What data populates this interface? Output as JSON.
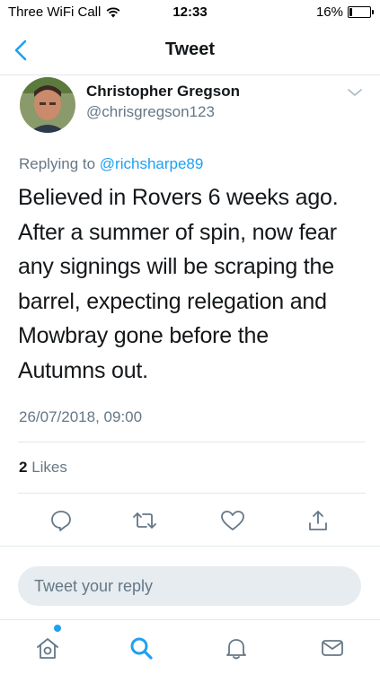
{
  "status_bar": {
    "carrier": "Three WiFi Call",
    "time": "12:33",
    "battery_percent": "16%",
    "battery_level": 0.16
  },
  "nav": {
    "title": "Tweet",
    "back_icon": "chevron-left-icon"
  },
  "tweet": {
    "author_name": "Christopher Gregson",
    "author_handle": "@chrisgregson123",
    "replying_prefix": "Replying to",
    "replying_to": "@richsharpe89",
    "text_lines": [
      "Believed in Rovers 6 weeks ago.",
      "After a summer of spin, now fear",
      "any signings will be scraping the",
      "barrel, expecting relegation and",
      "Mowbray gone before the",
      "Autumns out."
    ],
    "timestamp": "26/07/2018, 09:00",
    "likes_count": "2",
    "likes_label": "Likes"
  },
  "actions": [
    "reply-icon",
    "retweet-icon",
    "like-icon",
    "share-icon"
  ],
  "reply_box": {
    "placeholder": "Tweet your reply"
  },
  "tab_bar": {
    "items": [
      "home-icon",
      "search-icon",
      "notifications-icon",
      "messages-icon"
    ],
    "home_has_new": true
  },
  "colors": {
    "accent": "#1da1f2",
    "secondary_text": "#657786",
    "divider": "#e1e8ed",
    "reply_box_bg": "#e6ecf0"
  }
}
